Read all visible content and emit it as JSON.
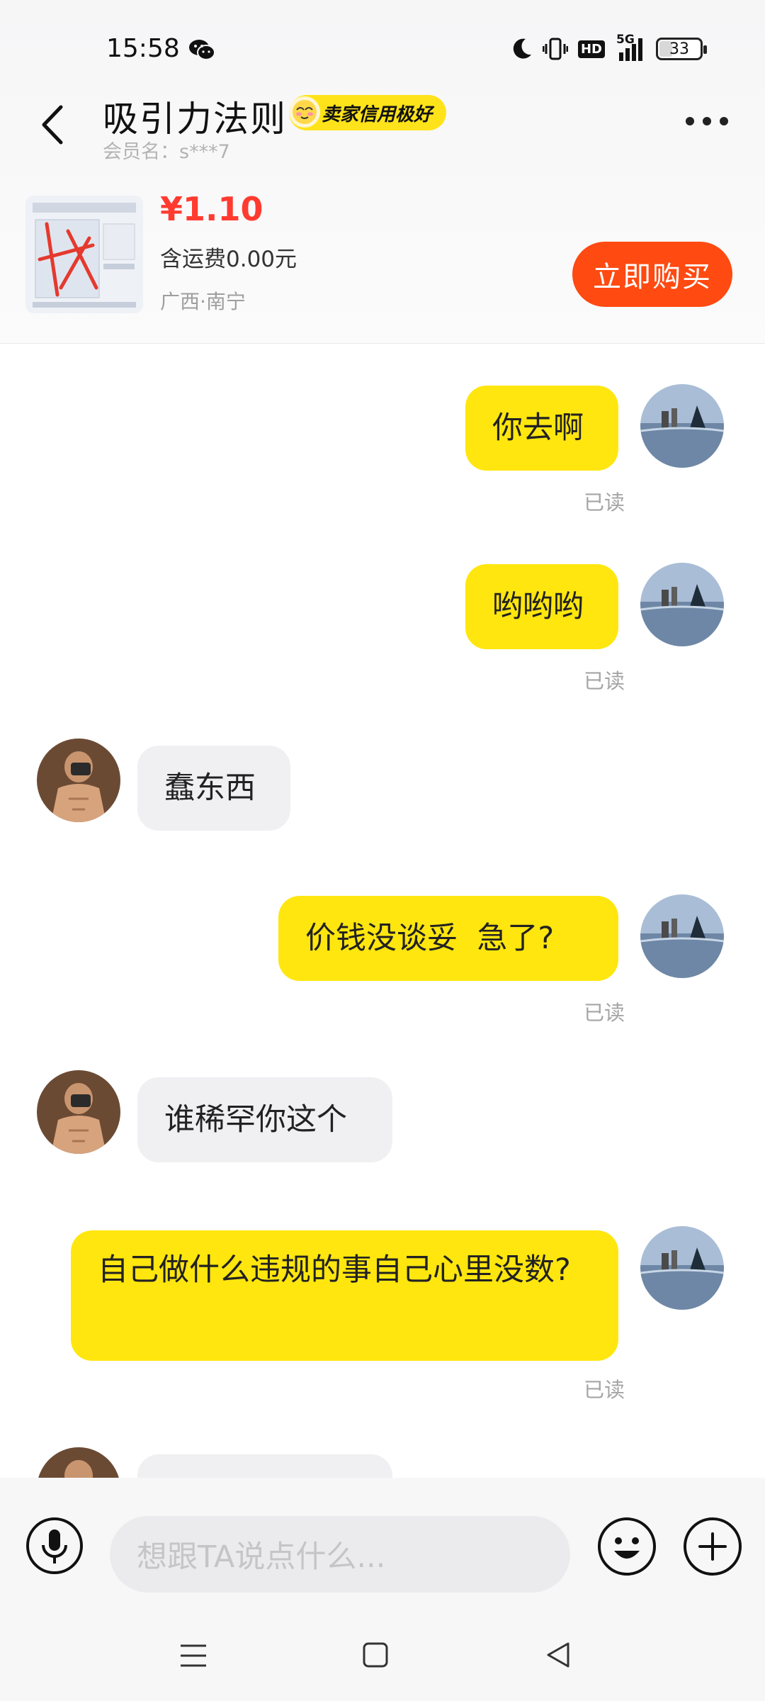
{
  "status_bar": {
    "time": "15:58",
    "network": "5G",
    "hd": "HD",
    "battery": "33"
  },
  "header": {
    "title": "吸引力法则",
    "badge": "卖家信用极好",
    "member_name": "会员名：s***7"
  },
  "product": {
    "price": "¥1.10",
    "shipping": "含运费0.00元",
    "location": "广西·南宁",
    "buy_label": "立即购买"
  },
  "messages": [
    {
      "direction": "sent",
      "text": "你去啊",
      "read": "已读"
    },
    {
      "direction": "sent",
      "text": "哟哟哟",
      "read": "已读"
    },
    {
      "direction": "received",
      "text": "蠢东西"
    },
    {
      "direction": "sent",
      "text": "价钱没谈妥  急了?",
      "read": "已读"
    },
    {
      "direction": "received",
      "text": "谁稀罕你这个"
    },
    {
      "direction": "sent",
      "text": "自己做什么违规的事自己心里没数?",
      "read": "已读"
    }
  ],
  "input": {
    "placeholder": "想跟TA说点什么..."
  },
  "colors": {
    "sent_bubble": "#ffe60f",
    "received_bubble": "#f0f0f3",
    "buy_button": "#ff4a11",
    "price": "#ff3b30",
    "badge": "#ffe31a"
  }
}
